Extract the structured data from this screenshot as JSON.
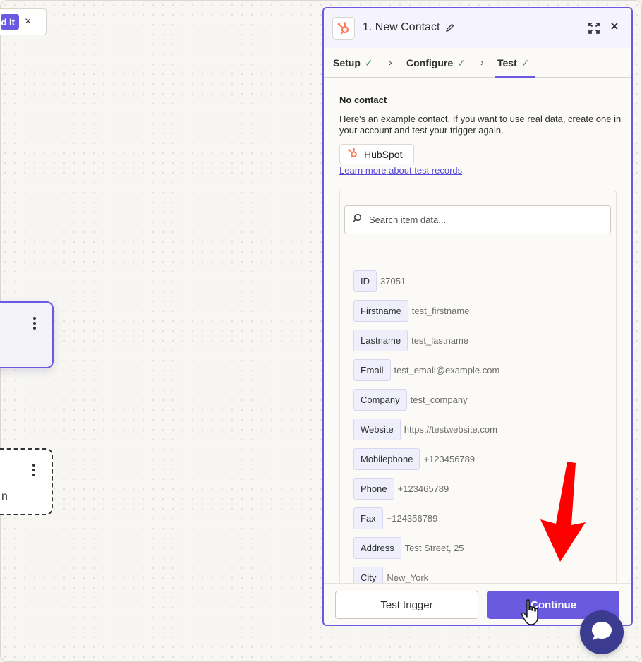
{
  "top_chip": {
    "publish_label": "d it",
    "close_label": "×"
  },
  "canvas": {
    "node_b_fragment": "n"
  },
  "panel": {
    "title": "1. New Contact",
    "steps": [
      {
        "label": "Setup",
        "done": true
      },
      {
        "label": "Configure",
        "done": true
      },
      {
        "label": "Test",
        "done": true
      }
    ],
    "check_mark": "✓",
    "no_contact_title": "No contact",
    "description": "Here's an example contact. If you want to use real data, create one in your account and test your trigger again.",
    "app_name": "HubSpot",
    "learn_more": "Learn more about test records",
    "search_placeholder": "Search item data...",
    "fields": [
      {
        "key": "ID",
        "value": "37051"
      },
      {
        "key": "Firstname",
        "value": "test_firstname"
      },
      {
        "key": "Lastname",
        "value": "test_lastname"
      },
      {
        "key": "Email",
        "value": "test_email@example.com"
      },
      {
        "key": "Company",
        "value": "test_company"
      },
      {
        "key": "Website",
        "value": "https://testwebsite.com"
      },
      {
        "key": "Mobilephone",
        "value": "+123456789"
      },
      {
        "key": "Phone",
        "value": "+123465789"
      },
      {
        "key": "Fax",
        "value": "+124356789"
      },
      {
        "key": "Address",
        "value": "Test Street, 25"
      },
      {
        "key": "City",
        "value": "New_York"
      }
    ],
    "test_trigger_label": "Test trigger",
    "continue_label": "Continue"
  },
  "icons": {
    "app": "hubspot-icon",
    "edit": "pencil-icon",
    "expand": "expand-icon",
    "close": "close-icon",
    "search": "search-icon",
    "chat": "chat-bubble-icon"
  },
  "colors": {
    "accent": "#6a5ae0",
    "hubspot_orange": "#ff7a59",
    "check_green": "#4a9a5c",
    "annotation_red": "#ff0000",
    "chat_bg": "#3b3b8f"
  }
}
